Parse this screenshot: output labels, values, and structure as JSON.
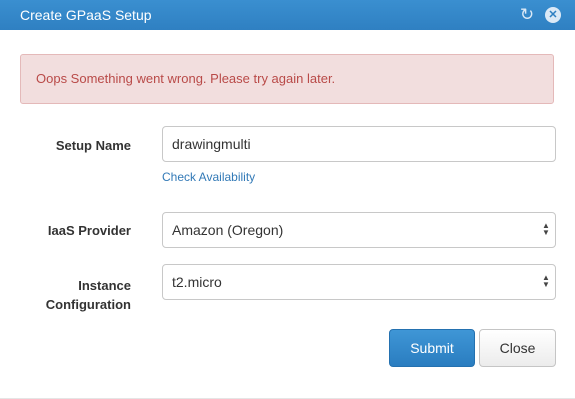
{
  "dialog": {
    "title": "Create GPaaS Setup",
    "icons": [
      "refresh-icon",
      "close-icon"
    ]
  },
  "alert": {
    "message": "Oops Something went wrong. Please try again later.",
    "color": "#b94a48",
    "background": "#f2dede"
  },
  "form": {
    "setup_name": {
      "label": "Setup Name",
      "value": "drawingmulti",
      "link": "Check Availability"
    },
    "iaas_provider": {
      "label": "IaaS Provider",
      "selected": "Amazon (Oregon)"
    },
    "instance_configuration": {
      "label_line1": "Instance",
      "label_line2": "Configuration",
      "selected": "t2.micro"
    }
  },
  "buttons": {
    "submit": "Submit",
    "close": "Close",
    "primary_color": "#2f80c2"
  }
}
